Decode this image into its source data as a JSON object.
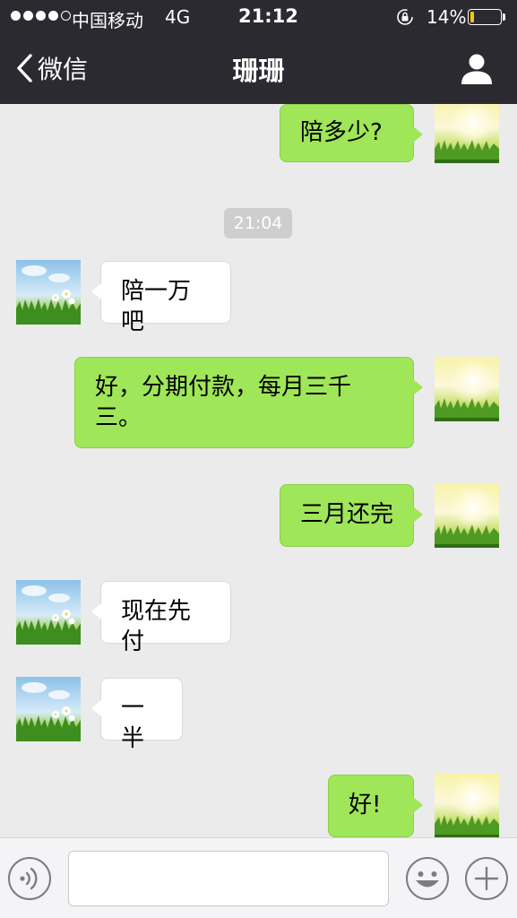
{
  "status_bar": {
    "carrier": "中国移动",
    "network": "4G",
    "time": "21:12",
    "battery_percent": "14%",
    "battery_level": 0.14,
    "signal_bars_filled": 4,
    "signal_bars_total": 5,
    "icons": {
      "rotation_lock": "rotation-lock-icon",
      "battery": "battery-icon"
    }
  },
  "nav": {
    "back_label": "微信",
    "title": "珊珊",
    "icons": {
      "back": "chevron-left-icon",
      "profile": "person-icon"
    }
  },
  "chat": {
    "timestamp": "21:04",
    "messages": [
      {
        "sender": "me",
        "text": "陪多少?"
      },
      {
        "sender": "them",
        "text": "陪一万吧"
      },
      {
        "sender": "me",
        "text": "好，分期付款，每月三千三。"
      },
      {
        "sender": "me",
        "text": "三月还完"
      },
      {
        "sender": "them",
        "text": "现在先付"
      },
      {
        "sender": "them",
        "text": "一半"
      },
      {
        "sender": "me",
        "text": "好!"
      }
    ]
  },
  "input_bar": {
    "placeholder": "",
    "icons": {
      "voice": "voice-icon",
      "emoji": "emoji-icon",
      "more": "plus-icon"
    }
  },
  "colors": {
    "header_bg": "#2b2a30",
    "chat_bg": "#ebebeb",
    "my_bubble": "#9fe658",
    "their_bubble": "#ffffff",
    "battery_fill": "#f6c700"
  }
}
